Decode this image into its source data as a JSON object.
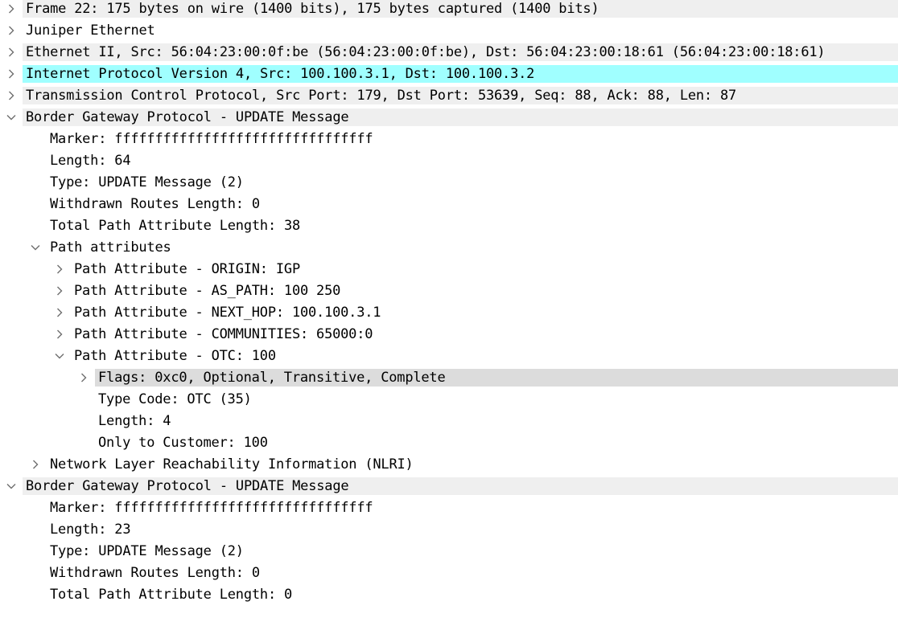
{
  "colors": {
    "selected_row": "#a0ffff",
    "header_row": "#efefef",
    "flags_row": "#dcdcdc",
    "chevron": "#6e6e6e"
  },
  "tree": [
    {
      "name": "frame",
      "text": "Frame 22: 175 bytes on wire (1400 bits), 175 bytes captured (1400 bits)",
      "depth": 0,
      "toggle": "collapsed",
      "style": "header"
    },
    {
      "name": "juniper-ethernet",
      "text": "Juniper Ethernet",
      "depth": 0,
      "toggle": "collapsed",
      "style": "plain"
    },
    {
      "name": "ethernet-ii",
      "text": "Ethernet II, Src: 56:04:23:00:0f:be (56:04:23:00:0f:be), Dst: 56:04:23:00:18:61 (56:04:23:00:18:61)",
      "depth": 0,
      "toggle": "collapsed",
      "style": "header"
    },
    {
      "name": "ipv4",
      "text": "Internet Protocol Version 4, Src: 100.100.3.1, Dst: 100.100.3.2",
      "depth": 0,
      "toggle": "collapsed",
      "style": "selected"
    },
    {
      "name": "tcp",
      "text": "Transmission Control Protocol, Src Port: 179, Dst Port: 53639, Seq: 88, Ack: 88, Len: 87",
      "depth": 0,
      "toggle": "collapsed",
      "style": "header"
    },
    {
      "name": "bgp-update-1",
      "text": "Border Gateway Protocol - UPDATE Message",
      "depth": 0,
      "toggle": "expanded",
      "style": "header"
    },
    {
      "name": "marker-1",
      "text": "Marker: ffffffffffffffffffffffffffffffff",
      "depth": 1,
      "toggle": "none",
      "style": "plain"
    },
    {
      "name": "length-1",
      "text": "Length: 64",
      "depth": 1,
      "toggle": "none",
      "style": "plain"
    },
    {
      "name": "type-1",
      "text": "Type: UPDATE Message (2)",
      "depth": 1,
      "toggle": "none",
      "style": "plain"
    },
    {
      "name": "withdrawn-length-1",
      "text": "Withdrawn Routes Length: 0",
      "depth": 1,
      "toggle": "none",
      "style": "plain"
    },
    {
      "name": "total-path-attr-length-1",
      "text": "Total Path Attribute Length: 38",
      "depth": 1,
      "toggle": "none",
      "style": "plain"
    },
    {
      "name": "path-attributes",
      "text": "Path attributes",
      "depth": 1,
      "toggle": "expanded",
      "style": "plain"
    },
    {
      "name": "path-attr-origin",
      "text": "Path Attribute - ORIGIN: IGP",
      "depth": 2,
      "toggle": "collapsed",
      "style": "plain"
    },
    {
      "name": "path-attr-as-path",
      "text": "Path Attribute - AS_PATH: 100 250",
      "depth": 2,
      "toggle": "collapsed",
      "style": "plain"
    },
    {
      "name": "path-attr-next-hop",
      "text": "Path Attribute - NEXT_HOP: 100.100.3.1",
      "depth": 2,
      "toggle": "collapsed",
      "style": "plain"
    },
    {
      "name": "path-attr-communities",
      "text": "Path Attribute - COMMUNITIES: 65000:0",
      "depth": 2,
      "toggle": "collapsed",
      "style": "plain"
    },
    {
      "name": "path-attr-otc",
      "text": "Path Attribute - OTC: 100",
      "depth": 2,
      "toggle": "expanded",
      "style": "plain"
    },
    {
      "name": "otc-flags",
      "text": "Flags: 0xc0, Optional, Transitive, Complete",
      "depth": 3,
      "toggle": "collapsed",
      "style": "flags"
    },
    {
      "name": "otc-type-code",
      "text": "Type Code: OTC (35)",
      "depth": 3,
      "toggle": "none",
      "style": "plain"
    },
    {
      "name": "otc-length",
      "text": "Length: 4",
      "depth": 3,
      "toggle": "none",
      "style": "plain"
    },
    {
      "name": "otc-only-to-customer",
      "text": "Only to Customer: 100",
      "depth": 3,
      "toggle": "none",
      "style": "plain"
    },
    {
      "name": "nlri",
      "text": "Network Layer Reachability Information (NLRI)",
      "depth": 1,
      "toggle": "collapsed",
      "style": "plain"
    },
    {
      "name": "bgp-update-2",
      "text": "Border Gateway Protocol - UPDATE Message",
      "depth": 0,
      "toggle": "expanded",
      "style": "header"
    },
    {
      "name": "marker-2",
      "text": "Marker: ffffffffffffffffffffffffffffffff",
      "depth": 1,
      "toggle": "none",
      "style": "plain"
    },
    {
      "name": "length-2",
      "text": "Length: 23",
      "depth": 1,
      "toggle": "none",
      "style": "plain"
    },
    {
      "name": "type-2",
      "text": "Type: UPDATE Message (2)",
      "depth": 1,
      "toggle": "none",
      "style": "plain"
    },
    {
      "name": "withdrawn-length-2",
      "text": "Withdrawn Routes Length: 0",
      "depth": 1,
      "toggle": "none",
      "style": "plain"
    },
    {
      "name": "total-path-attr-length-2",
      "text": "Total Path Attribute Length: 0",
      "depth": 1,
      "toggle": "none",
      "style": "plain"
    }
  ]
}
